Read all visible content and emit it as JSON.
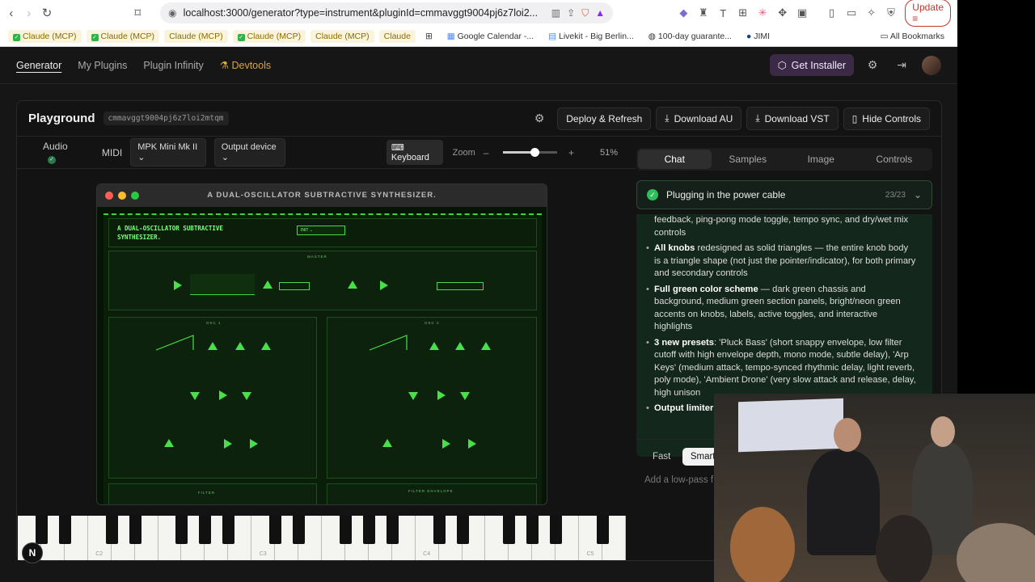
{
  "browser": {
    "url": "localhost:3000/generator?type=instrument&pluginId=cmmavggt9004pj6z7loi2...",
    "update_label": "Update",
    "bookmarks": [
      {
        "label": "Claude (MCP)",
        "check": true
      },
      {
        "label": "Claude (MCP)",
        "check": true
      },
      {
        "label": "Claude (MCP)",
        "check": false
      },
      {
        "label": "Claude (MCP)",
        "check": true
      },
      {
        "label": "Claude (MCP)",
        "check": false
      },
      {
        "label": "Claude",
        "check": false
      }
    ],
    "bookmarks_other": [
      "Google Calendar -...",
      "Livekit - Big Berlin...",
      "100-day guarante...",
      "JIMI"
    ],
    "all_bookmarks": "All Bookmarks"
  },
  "nav": {
    "items": [
      "Generator",
      "My Plugins",
      "Plugin Infinity"
    ],
    "devtools": "Devtools",
    "get_installer": "Get Installer"
  },
  "playground": {
    "title": "Playground",
    "id": "cmmavggt9004pj6z7loi2mtqm",
    "buttons": [
      "Deploy & Refresh",
      "Download AU",
      "Download VST",
      "Hide Controls"
    ],
    "audio_label": "Audio",
    "midi_label": "MIDI",
    "midi_device": "MPK Mini Mk II",
    "output_device": "Output device",
    "keyboard_label": "Keyboard",
    "zoom_label": "Zoom",
    "zoom_value": "51%",
    "zoom_fraction": 0.51
  },
  "plugin": {
    "window_title": "A DUAL-OSCILLATOR SUBTRACTIVE SYNTHESIZER.",
    "synth_title": "A DUAL-OSCILLATOR SUBTRACTIVE SYNTHESIZER.",
    "preset": "INIT",
    "master": "MASTER",
    "osc1": "OSC 1",
    "osc2": "OSC 2",
    "filter": "FILTER",
    "filter_env": "FILTER ENVELOPE",
    "piano_octaves": [
      "C2",
      "C3",
      "C4",
      "C5"
    ]
  },
  "chat": {
    "tabs": [
      "Chat",
      "Samples",
      "Image",
      "Controls"
    ],
    "status": "Plugging in the power cable",
    "count": "23/23",
    "lines": [
      {
        "bold": "",
        "text": "feedback, ping-pong mode toggle, tempo sync, and dry/wet mix controls"
      },
      {
        "bold": "All knobs",
        "text": " redesigned as solid triangles — the entire knob body is a triangle shape (not just the pointer/indicator), for both primary and secondary controls"
      },
      {
        "bold": "Full green color scheme",
        "text": " — dark green chassis and background, medium green section panels, bright/neon green accents on knobs, labels, active toggles, and interactive highlights"
      },
      {
        "bold": "3 new presets",
        "text": ": 'Pluck Bass' (short snappy envelope, low filter cutoff with high envelope depth, mono mode, subtle delay), 'Arp Keys' (medium attack, tempo-synced rhythmic delay, light reverb, poly mode), 'Ambient Drone' (very slow attack and release, delay, high unison"
      },
      {
        "bold": "Output limiter",
        "text": ""
      }
    ],
    "modes": [
      "Fast",
      "Smart"
    ],
    "prompt_placeholder": "Add a low-pass f"
  }
}
